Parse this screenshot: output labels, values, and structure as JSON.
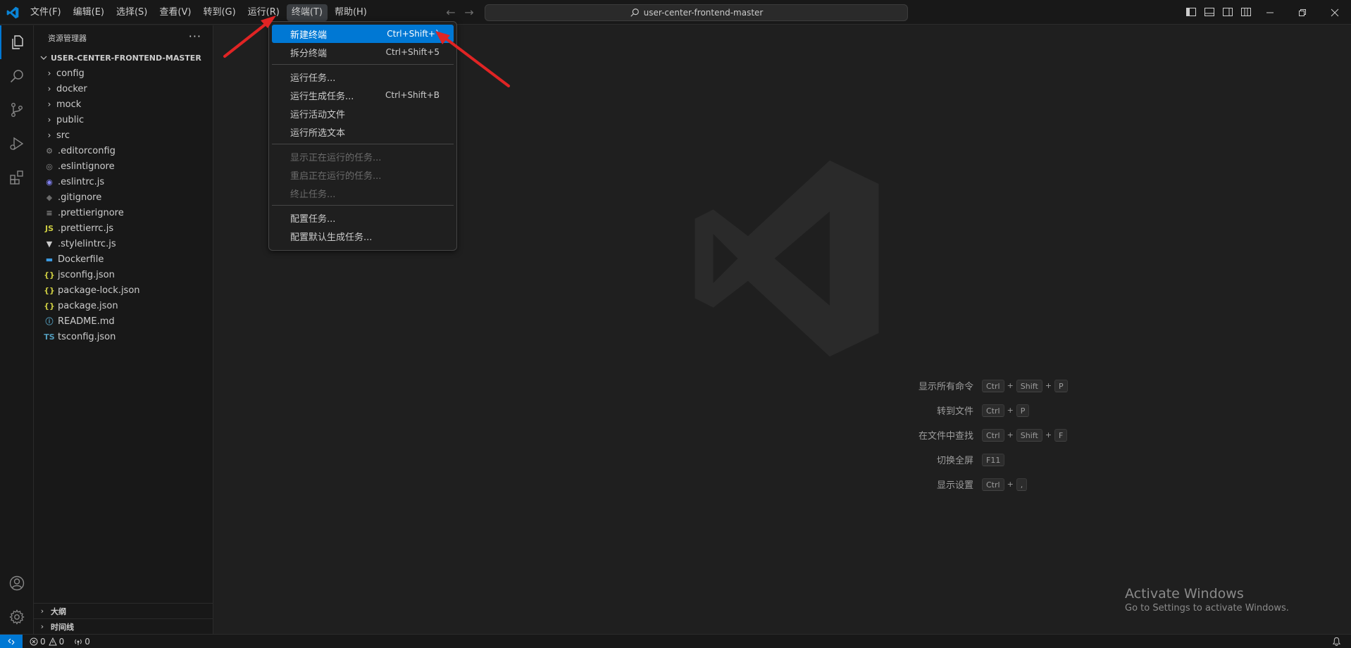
{
  "titlebar": {
    "menus": [
      "文件(F)",
      "编辑(E)",
      "选择(S)",
      "查看(V)",
      "转到(G)",
      "运行(R)",
      "终端(T)",
      "帮助(H)"
    ],
    "active_menu_index": 6,
    "search_text": "user-center-frontend-master"
  },
  "sidebar": {
    "header": "资源管理器",
    "more": "···",
    "root": "USER-CENTER-FRONTEND-MASTER",
    "folders": [
      "config",
      "docker",
      "mock",
      "public",
      "src"
    ],
    "files": [
      {
        "name": ".editorconfig",
        "icon": "gear-icon",
        "glyph": "⚙",
        "color": "#8a8a8a"
      },
      {
        "name": ".eslintignore",
        "icon": "eslint-icon",
        "glyph": "◎",
        "color": "#8a8a8a"
      },
      {
        "name": ".eslintrc.js",
        "icon": "eslint-icon",
        "glyph": "◉",
        "color": "#8080f0"
      },
      {
        "name": ".gitignore",
        "icon": "git-icon",
        "glyph": "◆",
        "color": "#6a6a6a"
      },
      {
        "name": ".prettierignore",
        "icon": "prettier-icon",
        "glyph": "≡",
        "color": "#8a8a8a"
      },
      {
        "name": ".prettierrc.js",
        "icon": "js-icon",
        "glyph": "JS",
        "color": "#cbcb41"
      },
      {
        "name": ".stylelintrc.js",
        "icon": "stylelint-icon",
        "glyph": "▼",
        "color": "#cccccc"
      },
      {
        "name": "Dockerfile",
        "icon": "docker-icon",
        "glyph": "▬",
        "color": "#3b9ae1"
      },
      {
        "name": "jsconfig.json",
        "icon": "json-icon",
        "glyph": "{}",
        "color": "#cbcb41"
      },
      {
        "name": "package-lock.json",
        "icon": "json-icon",
        "glyph": "{}",
        "color": "#cbcb41"
      },
      {
        "name": "package.json",
        "icon": "json-icon",
        "glyph": "{}",
        "color": "#cbcb41"
      },
      {
        "name": "README.md",
        "icon": "info-icon",
        "glyph": "ⓘ",
        "color": "#519aba"
      },
      {
        "name": "tsconfig.json",
        "icon": "ts-icon",
        "glyph": "TS",
        "color": "#519aba"
      }
    ],
    "outline": "大纲",
    "timeline": "时间线"
  },
  "terminal_menu": {
    "groups": [
      [
        {
          "label": "新建终端",
          "shortcut": "Ctrl+Shift+`",
          "selected": true,
          "disabled": false
        },
        {
          "label": "拆分终端",
          "shortcut": "Ctrl+Shift+5",
          "selected": false,
          "disabled": false
        }
      ],
      [
        {
          "label": "运行任务...",
          "shortcut": "",
          "selected": false,
          "disabled": false
        },
        {
          "label": "运行生成任务...",
          "shortcut": "Ctrl+Shift+B",
          "selected": false,
          "disabled": false
        },
        {
          "label": "运行活动文件",
          "shortcut": "",
          "selected": false,
          "disabled": false
        },
        {
          "label": "运行所选文本",
          "shortcut": "",
          "selected": false,
          "disabled": false
        }
      ],
      [
        {
          "label": "显示正在运行的任务...",
          "shortcut": "",
          "selected": false,
          "disabled": true
        },
        {
          "label": "重启正在运行的任务...",
          "shortcut": "",
          "selected": false,
          "disabled": true
        },
        {
          "label": "终止任务...",
          "shortcut": "",
          "selected": false,
          "disabled": true
        }
      ],
      [
        {
          "label": "配置任务...",
          "shortcut": "",
          "selected": false,
          "disabled": false
        },
        {
          "label": "配置默认生成任务...",
          "shortcut": "",
          "selected": false,
          "disabled": false
        }
      ]
    ]
  },
  "editor": {
    "shortcuts": [
      {
        "label": "显示所有命令",
        "keys": [
          "Ctrl",
          "Shift",
          "P"
        ]
      },
      {
        "label": "转到文件",
        "keys": [
          "Ctrl",
          "P"
        ]
      },
      {
        "label": "在文件中查找",
        "keys": [
          "Ctrl",
          "Shift",
          "F"
        ]
      },
      {
        "label": "切换全屏",
        "keys": [
          "F11"
        ]
      },
      {
        "label": "显示设置",
        "keys": [
          "Ctrl",
          ","
        ]
      }
    ],
    "activate_title": "Activate Windows",
    "activate_sub": "Go to Settings to activate Windows."
  },
  "statusbar": {
    "errors": "0",
    "warnings": "0",
    "ports": "0"
  },
  "colors": {
    "accent": "#0078d4",
    "annotation_arrow": "#e02424"
  }
}
